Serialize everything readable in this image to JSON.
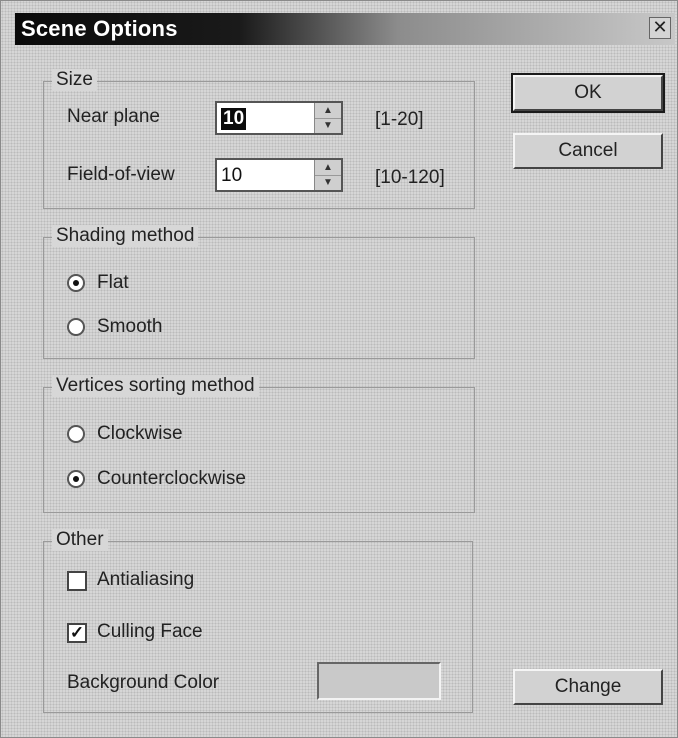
{
  "window": {
    "title": "Scene Options",
    "close_symbol": "✕"
  },
  "size": {
    "legend": "Size",
    "near_plane": {
      "label": "Near plane",
      "value": "10",
      "range": "[1-20]"
    },
    "field_of_view": {
      "label": "Field-of-view",
      "value": "10",
      "range": "[10-120]"
    },
    "up_arrow_icon": "▲",
    "down_arrow_icon": "▼"
  },
  "shading": {
    "legend": "Shading method",
    "options": [
      {
        "label": "Flat",
        "selected": true
      },
      {
        "label": "Smooth",
        "selected": false
      }
    ]
  },
  "sorting": {
    "legend": "Vertices sorting method",
    "options": [
      {
        "label": "Clockwise",
        "selected": false
      },
      {
        "label": "Counterclockwise",
        "selected": true
      }
    ]
  },
  "other": {
    "legend": "Other",
    "antialiasing": {
      "label": "Antialiasing",
      "checked": false
    },
    "culling_face": {
      "label": "Culling Face",
      "checked": true,
      "mark": "✓"
    },
    "background_color_label": "Background Color",
    "background_color_value": "#c9c9c9"
  },
  "buttons": {
    "ok": "OK",
    "cancel": "Cancel",
    "change": "Change"
  }
}
